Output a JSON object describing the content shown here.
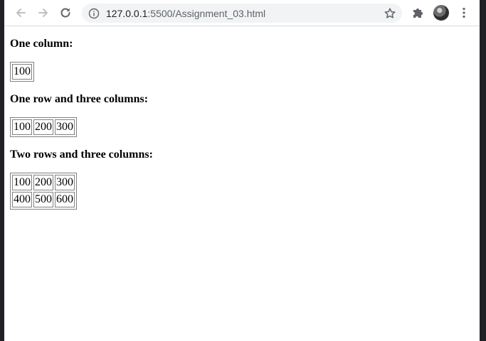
{
  "browser": {
    "url_host": "127.0.0.1",
    "url_rest": ":5500/Assignment_03.html",
    "icons": {
      "back": "arrow-left",
      "forward": "arrow-right",
      "reload": "reload",
      "site_info": "info-circle",
      "bookmark": "star-outline",
      "extensions": "puzzle-piece",
      "menu": "vertical-dots"
    }
  },
  "content": {
    "section1": {
      "heading": "One column:",
      "rows": [
        [
          "100"
        ]
      ]
    },
    "section2": {
      "heading": "One row and three columns:",
      "rows": [
        [
          "100",
          "200",
          "300"
        ]
      ]
    },
    "section3": {
      "heading": "Two rows and three columns:",
      "rows": [
        [
          "100",
          "200",
          "300"
        ],
        [
          "400",
          "500",
          "600"
        ]
      ]
    }
  }
}
